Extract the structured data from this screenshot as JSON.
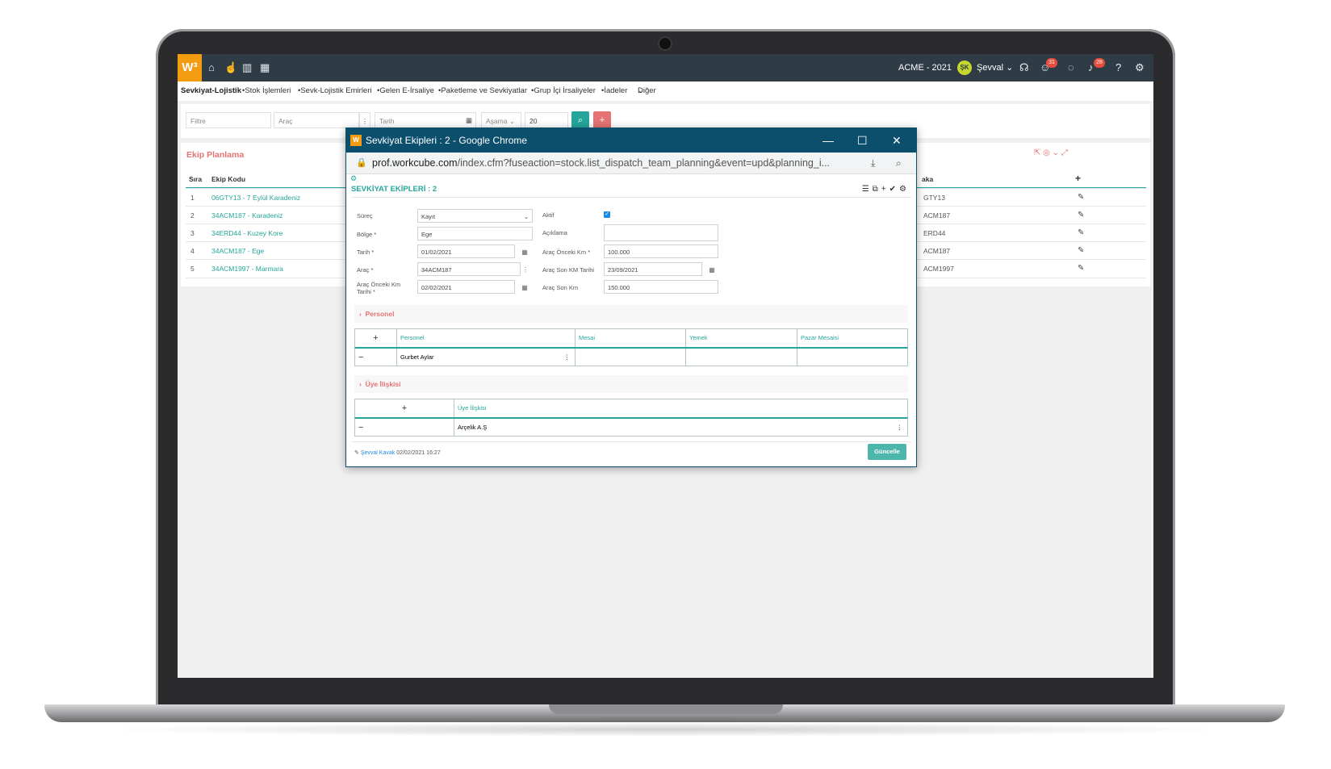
{
  "app": {
    "logo": "W³",
    "company": "ACME - 2021",
    "user_initials": "ŞK",
    "user_name": "Şevval",
    "notif_chat": "31",
    "notif_bell": "28"
  },
  "menu": [
    "Sevkiyat-Lojistik",
    "Stok İşlemleri",
    "Sevk-Lojistik Emirleri",
    "Gelen E-İrsaliye",
    "Paketleme ve Sevkiyatlar",
    "Grup İçi İrsaliyeler",
    "İadeler",
    "Diğer"
  ],
  "filters": {
    "filter_placeholder": "Filtre",
    "vehicle_placeholder": "Araç",
    "date_placeholder": "Tarih",
    "stage_placeholder": "Aşama",
    "page_size": "20"
  },
  "list": {
    "title": "Ekip Planlama",
    "col_no": "Sıra",
    "col_code": "Ekip Kodu",
    "col_plate": "aka",
    "rows": [
      {
        "no": "1",
        "code": "06GTY13 - 7 Eylül Karadeniz",
        "plate": "GTY13"
      },
      {
        "no": "2",
        "code": "34ACM187 - Karadeniz",
        "plate": "ACM187"
      },
      {
        "no": "3",
        "code": "34ERD44 - Kuzey Kore",
        "plate": "ERD44"
      },
      {
        "no": "4",
        "code": "34ACM187 - Ege",
        "plate": "ACM187"
      },
      {
        "no": "5",
        "code": "34ACM1997 - Marmara",
        "plate": "ACM1997"
      }
    ]
  },
  "popup": {
    "window_title": "Sevkiyat Ekipleri : 2 - Google Chrome",
    "url_domain": "prof.workcube.com",
    "url_path": "/index.cfm?fuseaction=stock.list_dispatch_team_planning&event=upd&planning_i...",
    "section_title": "SEVKİYAT EKİPLERİ : 2",
    "fields": {
      "surec_label": "Süreç",
      "surec_value": "Kayıt",
      "bolge_label": "Bölge *",
      "bolge_value": "Ege",
      "tarih_label": "Tarih *",
      "tarih_value": "01/02/2021",
      "arac_label": "Araç *",
      "arac_value": "34ACM187",
      "onceki_tarih_label": "Araç Önceki Km Tarihi *",
      "onceki_tarih_value": "02/02/2021",
      "aktif_label": "Aktif",
      "aciklama_label": "Açıklama",
      "onceki_km_label": "Araç Önceki Km *",
      "onceki_km_value": "100.000",
      "son_tarih_label": "Araç Son KM Tarihi",
      "son_tarih_value": "23/09/2021",
      "son_km_label": "Araç Son Km",
      "son_km_value": "150.000"
    },
    "personel": {
      "section": "Personel",
      "headers": [
        "Personel",
        "Mesai",
        "Yemek",
        "Pazar Mesaisi"
      ],
      "rows": [
        {
          "name": "Gurbet Aylar"
        }
      ]
    },
    "uye": {
      "section": "Üye İlişkisi",
      "header": "Üye İlişkisi",
      "rows": [
        {
          "name": "Arçelik A.Ş"
        }
      ]
    },
    "footer": {
      "user": "Şevval Kavak",
      "datetime": "02/02/2021 16:27",
      "update_label": "Güncelle"
    }
  }
}
